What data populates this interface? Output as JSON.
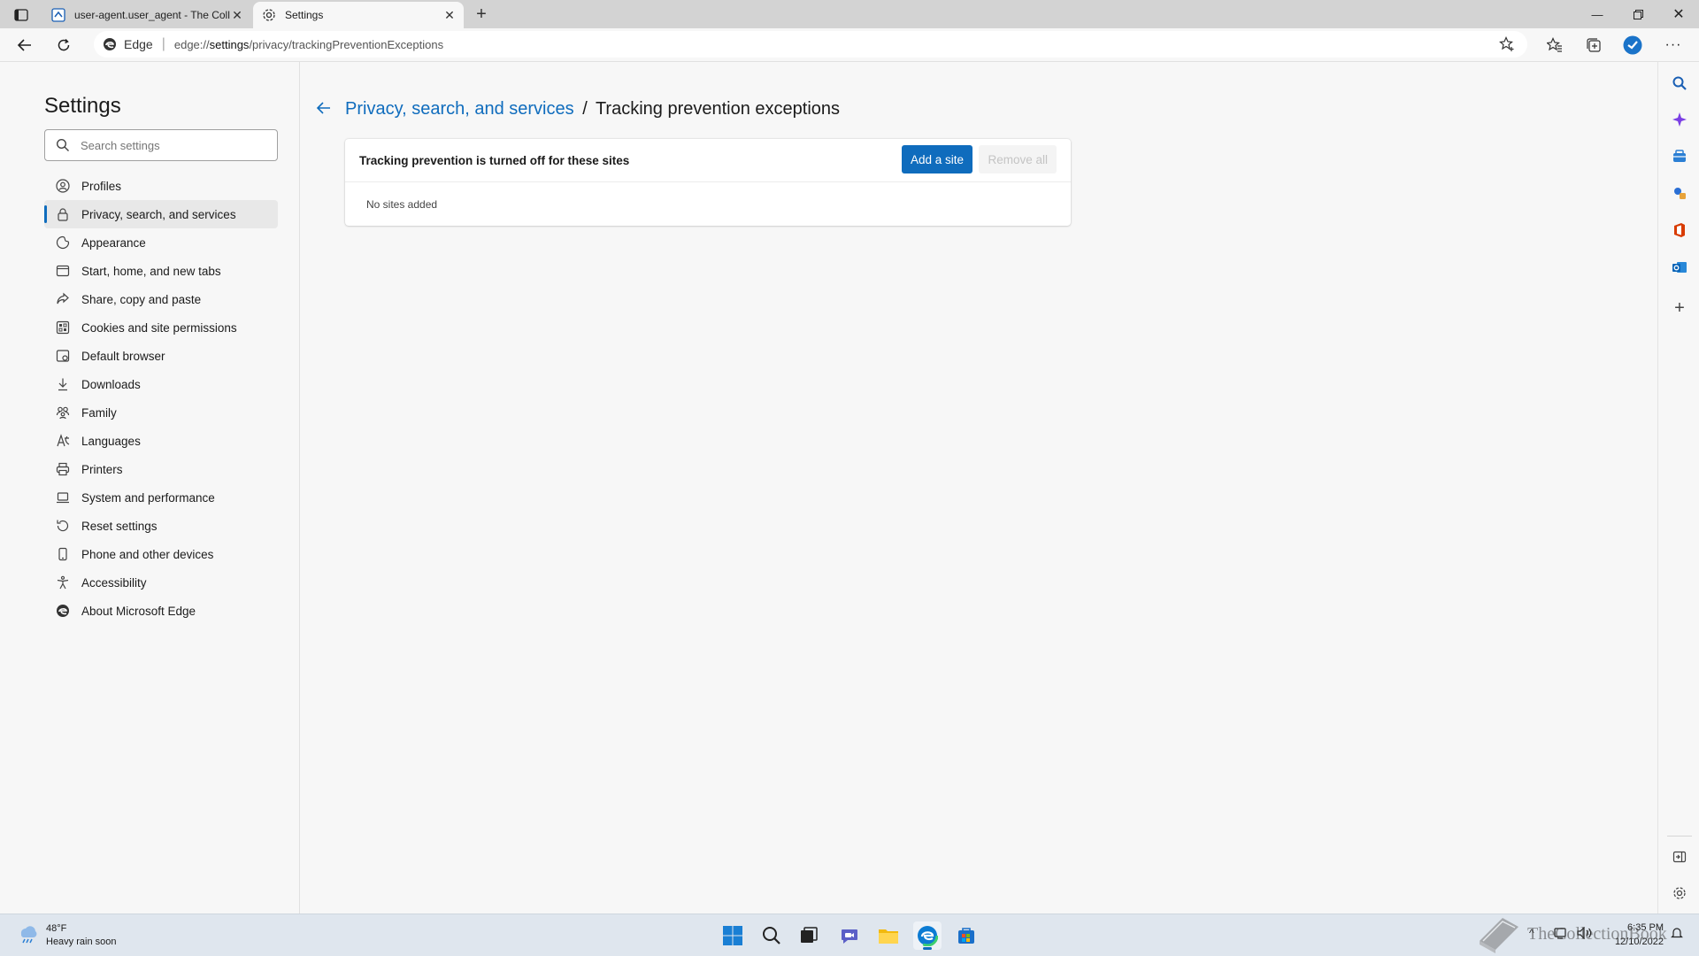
{
  "browser": {
    "tabs": [
      {
        "title": "user-agent.user_agent - The Coll",
        "active": false
      },
      {
        "title": "Settings",
        "active": true
      }
    ],
    "address": {
      "identity_label": "Edge",
      "url_prefix": "edge://",
      "url_main": "settings",
      "url_rest": "/privacy/trackingPreventionExceptions"
    }
  },
  "settings": {
    "title": "Settings",
    "search_placeholder": "Search settings",
    "nav": [
      {
        "label": "Profiles",
        "icon": "profile-icon"
      },
      {
        "label": "Privacy, search, and services",
        "icon": "lock-icon",
        "active": true
      },
      {
        "label": "Appearance",
        "icon": "appearance-icon"
      },
      {
        "label": "Start, home, and new tabs",
        "icon": "home-tabs-icon"
      },
      {
        "label": "Share, copy and paste",
        "icon": "share-icon"
      },
      {
        "label": "Cookies and site permissions",
        "icon": "cookies-icon"
      },
      {
        "label": "Default browser",
        "icon": "default-browser-icon"
      },
      {
        "label": "Downloads",
        "icon": "download-icon"
      },
      {
        "label": "Family",
        "icon": "family-icon"
      },
      {
        "label": "Languages",
        "icon": "languages-icon"
      },
      {
        "label": "Printers",
        "icon": "printer-icon"
      },
      {
        "label": "System and performance",
        "icon": "laptop-icon"
      },
      {
        "label": "Reset settings",
        "icon": "reset-icon"
      },
      {
        "label": "Phone and other devices",
        "icon": "phone-icon"
      },
      {
        "label": "Accessibility",
        "icon": "accessibility-icon"
      },
      {
        "label": "About Microsoft Edge",
        "icon": "edge-logo-icon"
      }
    ]
  },
  "page": {
    "breadcrumb_parent": "Privacy, search, and services",
    "breadcrumb_separator": "/",
    "breadcrumb_current": "Tracking prevention exceptions",
    "card_title": "Tracking prevention is turned off for these sites",
    "add_button": "Add a site",
    "remove_all_button": "Remove all",
    "empty_text": "No sites added"
  },
  "taskbar": {
    "weather_temp": "48°F",
    "weather_desc": "Heavy rain soon",
    "time": "6:35 PM",
    "date": "12/10/2022",
    "watermark_text": "TheCollectionBook"
  },
  "colors": {
    "accent": "#0f6cbd",
    "panel_bg": "#f7f7f7",
    "tabstrip_bg": "#d3d3d3"
  }
}
